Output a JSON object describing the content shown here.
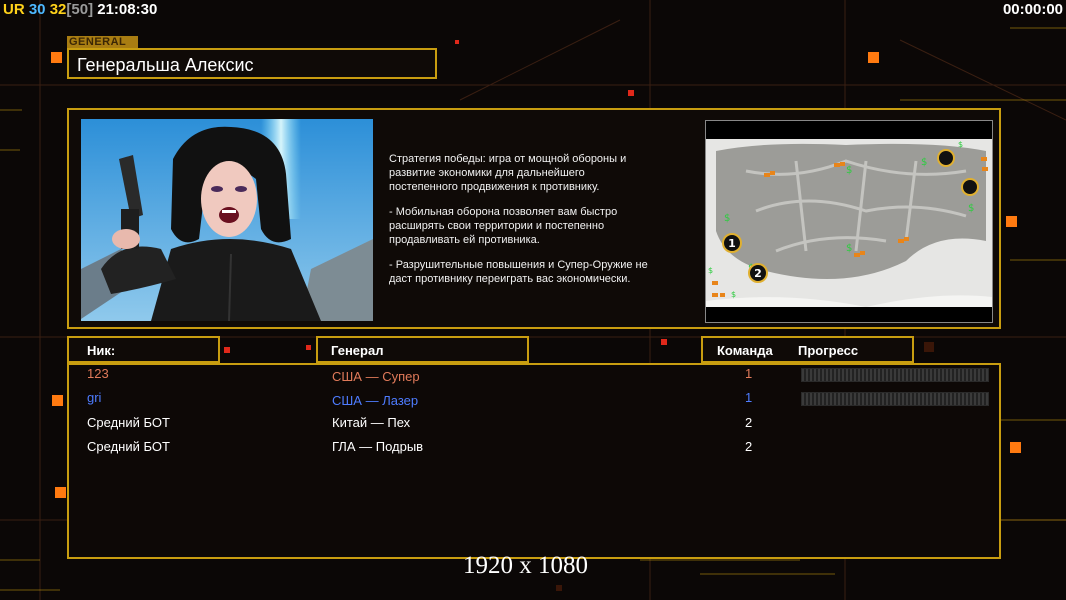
{
  "hud": {
    "ur_label": "UR",
    "val1": "30",
    "val2": "32",
    "val3": "[50]",
    "clock": "21:08:30",
    "timer": "00:00:00",
    "colors": {
      "ur": "#ffd21a",
      "val1": "#4db8ff",
      "val2": "#ffd21a",
      "val3": "#9a9a9a"
    }
  },
  "general": {
    "section_tag": "GENERAL",
    "name": "Генеральша Алексис"
  },
  "description": [
    "Стратегия победы: игра от мощной обороны и\n развитие экономики для дальнейшего\n постепенного продвижения к противнику.",
    "- Мобильная оборона позволяет вам быстро\n расширять свои территории и постепенно\n продавливать ей противника.",
    "- Разрушительные повышения и Супер-Оружие не\n даст противнику переиграть вас экономически."
  ],
  "map": {
    "start_positions": [
      "1",
      "2"
    ]
  },
  "table": {
    "headers": {
      "nick": "Ник:",
      "general": "Генерал",
      "team": "Команда",
      "progress": "Прогресс"
    },
    "rows": [
      {
        "nick": "123",
        "general": "США — Супер",
        "team": "1",
        "color": "#e07a5a",
        "progress": 0
      },
      {
        "nick": "gri",
        "general": "США — Лазер",
        "team": "1",
        "color": "#4e7cff",
        "progress": 0
      },
      {
        "nick": "Средний БОТ",
        "general": "Китай — Пех",
        "team": "2",
        "color": "#ffffff",
        "progress": null
      },
      {
        "nick": "Средний БОТ",
        "general": "ГЛА — Подрыв",
        "team": "2",
        "color": "#ffffff",
        "progress": null
      }
    ]
  },
  "resolution": "1920 x 1080",
  "accent_color": "#c89d10"
}
